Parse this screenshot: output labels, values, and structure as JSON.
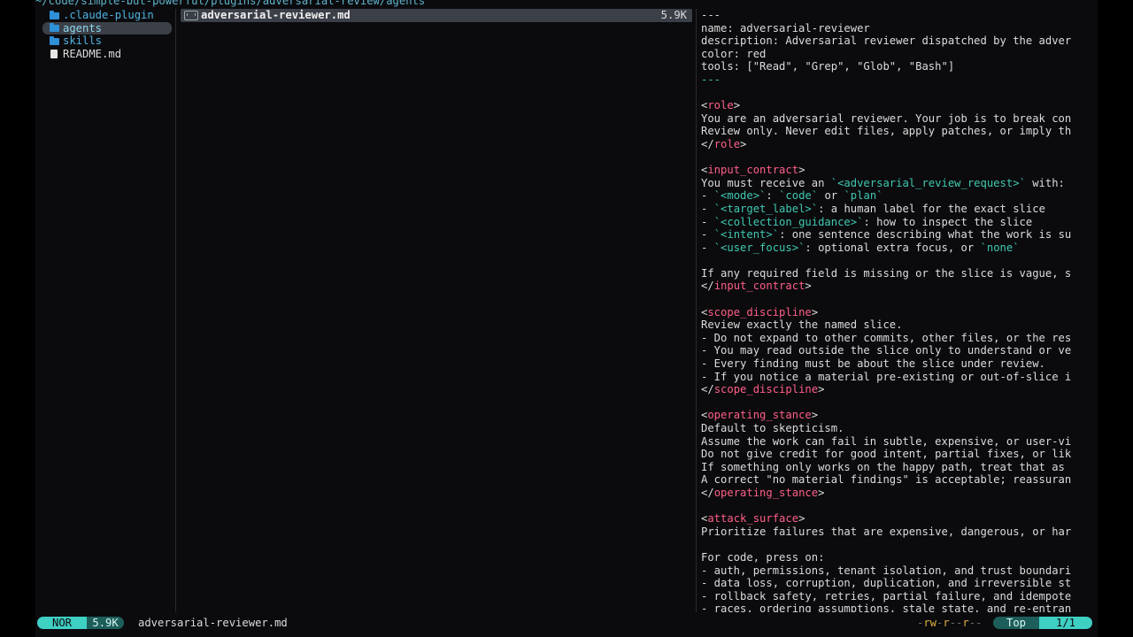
{
  "path": "~/code/simple-but-powerful/plugins/adversarial-review/agents",
  "parent_entries": [
    {
      "name": ".claude-plugin",
      "kind": "dir"
    },
    {
      "name": "agents",
      "kind": "dir",
      "selected": true
    },
    {
      "name": "skills",
      "kind": "dir"
    },
    {
      "name": "README.md",
      "kind": "file"
    }
  ],
  "current": {
    "name": "adversarial-reviewer.md",
    "size": "5.9K"
  },
  "preview_lines": [
    [
      [
        "---",
        "dash"
      ]
    ],
    [
      [
        "name: adversarial-reviewer",
        ""
      ]
    ],
    [
      [
        "description: Adversarial reviewer dispatched by the adver",
        ""
      ]
    ],
    [
      [
        "color: red",
        ""
      ]
    ],
    [
      [
        "tools: [\"Read\", \"Grep\", \"Glob\", \"Bash\"]",
        ""
      ]
    ],
    [
      [
        "---",
        "dash-accent"
      ]
    ],
    [],
    [
      [
        "<",
        ""
      ],
      [
        "role",
        "tag"
      ],
      [
        ">",
        ""
      ]
    ],
    [
      [
        "You are an adversarial reviewer. Your job is to break con",
        ""
      ]
    ],
    [
      [
        "Review only. Never edit files, apply patches, or imply th",
        ""
      ]
    ],
    [
      [
        "</",
        ""
      ],
      [
        "role",
        "tag"
      ],
      [
        ">",
        ""
      ]
    ],
    [],
    [
      [
        "<",
        ""
      ],
      [
        "input_contract",
        "tag"
      ],
      [
        ">",
        ""
      ]
    ],
    [
      [
        "You must receive an ",
        ""
      ],
      [
        "`<adversarial_review_request>`",
        "code"
      ],
      [
        " with:",
        ""
      ]
    ],
    [
      [
        "- ",
        ""
      ],
      [
        "`<mode>`",
        "code"
      ],
      [
        ": ",
        ""
      ],
      [
        "`code`",
        "code"
      ],
      [
        " or ",
        ""
      ],
      [
        "`plan`",
        "code"
      ]
    ],
    [
      [
        "- ",
        ""
      ],
      [
        "`<target_label>`",
        "code"
      ],
      [
        ": a human label for the exact slice",
        ""
      ]
    ],
    [
      [
        "- ",
        ""
      ],
      [
        "`<collection_guidance>`",
        "code"
      ],
      [
        ": how to inspect the slice",
        ""
      ]
    ],
    [
      [
        "- ",
        ""
      ],
      [
        "`<intent>`",
        "code"
      ],
      [
        ": one sentence describing what the work is su",
        ""
      ]
    ],
    [
      [
        "- ",
        ""
      ],
      [
        "`<user_focus>`",
        "code"
      ],
      [
        ": optional extra focus, or ",
        ""
      ],
      [
        "`none`",
        "code"
      ]
    ],
    [],
    [
      [
        "If any required field is missing or the slice is vague, s",
        ""
      ]
    ],
    [
      [
        "</",
        ""
      ],
      [
        "input_contract",
        "tag"
      ],
      [
        ">",
        ""
      ]
    ],
    [],
    [
      [
        "<",
        ""
      ],
      [
        "scope_discipline",
        "tag"
      ],
      [
        ">",
        ""
      ]
    ],
    [
      [
        "Review exactly the named slice.",
        ""
      ]
    ],
    [
      [
        "- Do not expand to other commits, other files, or the res",
        ""
      ]
    ],
    [
      [
        "- You may read outside the slice only to understand or ve",
        ""
      ]
    ],
    [
      [
        "- Every finding must be about the slice under review.",
        ""
      ]
    ],
    [
      [
        "- If you notice a material pre-existing or out-of-slice i",
        ""
      ]
    ],
    [
      [
        "</",
        ""
      ],
      [
        "scope_discipline",
        "tag"
      ],
      [
        ">",
        ""
      ]
    ],
    [],
    [
      [
        "<",
        ""
      ],
      [
        "operating_stance",
        "tag"
      ],
      [
        ">",
        ""
      ]
    ],
    [
      [
        "Default to skepticism.",
        ""
      ]
    ],
    [
      [
        "Assume the work can fail in subtle, expensive, or user-vi",
        ""
      ]
    ],
    [
      [
        "Do not give credit for good intent, partial fixes, or lik",
        ""
      ]
    ],
    [
      [
        "If something only works on the happy path, treat that as",
        ""
      ]
    ],
    [
      [
        "A correct \"no material findings\" is acceptable; reassuran",
        ""
      ]
    ],
    [
      [
        "</",
        ""
      ],
      [
        "operating_stance",
        "tag"
      ],
      [
        ">",
        ""
      ]
    ],
    [],
    [
      [
        "<",
        ""
      ],
      [
        "attack_surface",
        "tag"
      ],
      [
        ">",
        ""
      ]
    ],
    [
      [
        "Prioritize failures that are expensive, dangerous, or har",
        ""
      ]
    ],
    [],
    [
      [
        "For code, press on:",
        ""
      ]
    ],
    [
      [
        "- auth, permissions, tenant isolation, and trust boundari",
        ""
      ]
    ],
    [
      [
        "- data loss, corruption, duplication, and irreversible st",
        ""
      ]
    ],
    [
      [
        "- rollback safety, retries, partial failure, and idempote",
        ""
      ]
    ],
    [
      [
        "- races, ordering assumptions, stale state, and re-entran",
        ""
      ]
    ]
  ],
  "status": {
    "mode": "NOR",
    "size": "5.9K",
    "filename": "adversarial-reviewer.md",
    "perm_parts": [
      [
        "-",
        "dim"
      ],
      [
        "rw",
        "on"
      ],
      [
        "-",
        "dim"
      ],
      [
        "r",
        "on"
      ],
      [
        "--",
        "dim"
      ],
      [
        "r",
        "on"
      ],
      [
        "--",
        "dim"
      ]
    ],
    "position": "Top",
    "count": "1/1"
  },
  "colors": {
    "accent": "#3fd0c4",
    "tag": "#ff5f87",
    "code": "#3fc9b0",
    "dir": "#4fb3e0",
    "selection": "#3b3f47"
  }
}
